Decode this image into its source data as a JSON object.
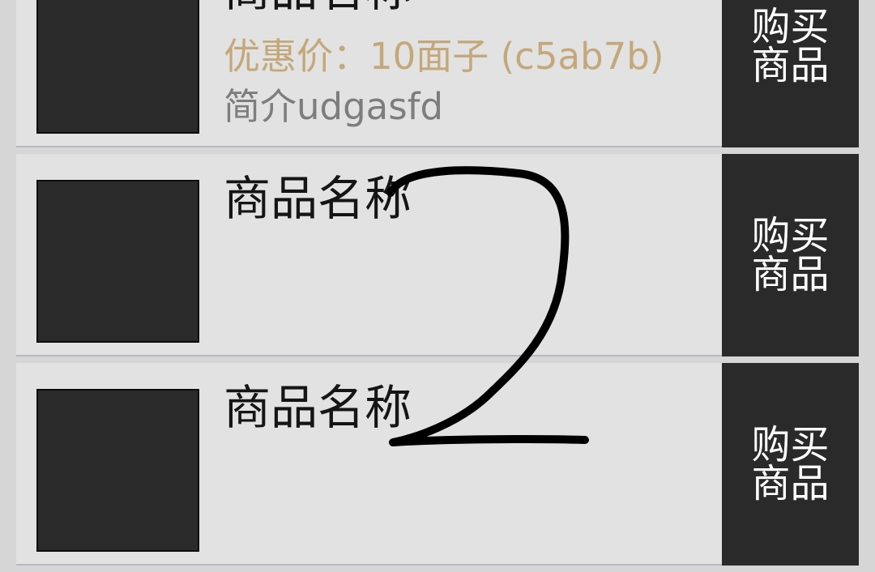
{
  "items": [
    {
      "title": "商品名称",
      "price": "优惠价：10面子 (c5ab7b)",
      "description": "简介udgasfd",
      "buy_label": "购买商品"
    },
    {
      "title": "商品名称",
      "price": "",
      "description": "",
      "buy_label": "购买商品"
    },
    {
      "title": "商品名称",
      "price": "",
      "description": "",
      "buy_label": "购买商品"
    }
  ],
  "colors": {
    "background": "#d6d6d6",
    "card": "#e2e2e2",
    "button": "#2a2a2a",
    "price": "#c4a87a",
    "description": "#7d7d7d"
  }
}
